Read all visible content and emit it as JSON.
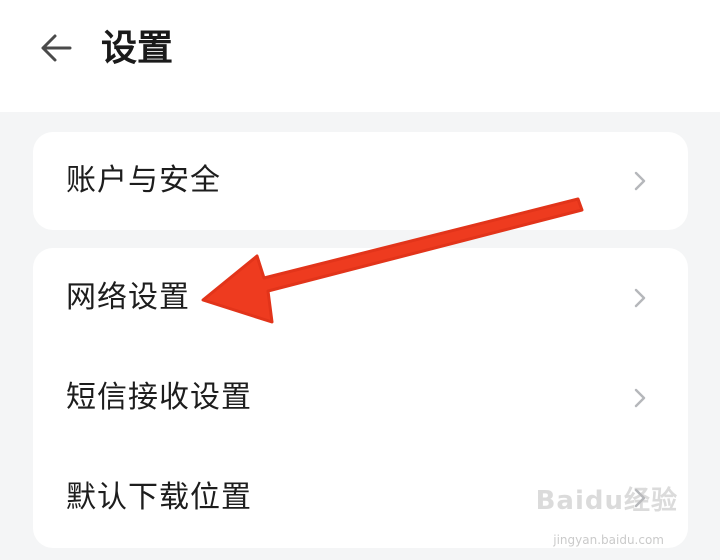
{
  "header": {
    "title": "设置",
    "back_icon": "arrow-left-icon"
  },
  "groups": [
    {
      "items": [
        {
          "label": "账户与安全",
          "icon": "chevron-right-icon"
        }
      ]
    },
    {
      "items": [
        {
          "label": "网络设置",
          "icon": "chevron-right-icon"
        },
        {
          "label": "短信接收设置",
          "icon": "chevron-right-icon"
        },
        {
          "label": "默认下载位置",
          "icon": "chevron-right-icon"
        }
      ]
    }
  ],
  "annotation": {
    "type": "red-arrow",
    "color": "#ee3b1f",
    "points_to": "网络设置"
  },
  "watermark": {
    "text": "Baidu经验",
    "subtext": "jingyan.baidu.com"
  },
  "colors": {
    "background": "#f4f5f6",
    "card": "#ffffff",
    "text": "#1d1d1d",
    "chevron": "#b5b7bb"
  }
}
